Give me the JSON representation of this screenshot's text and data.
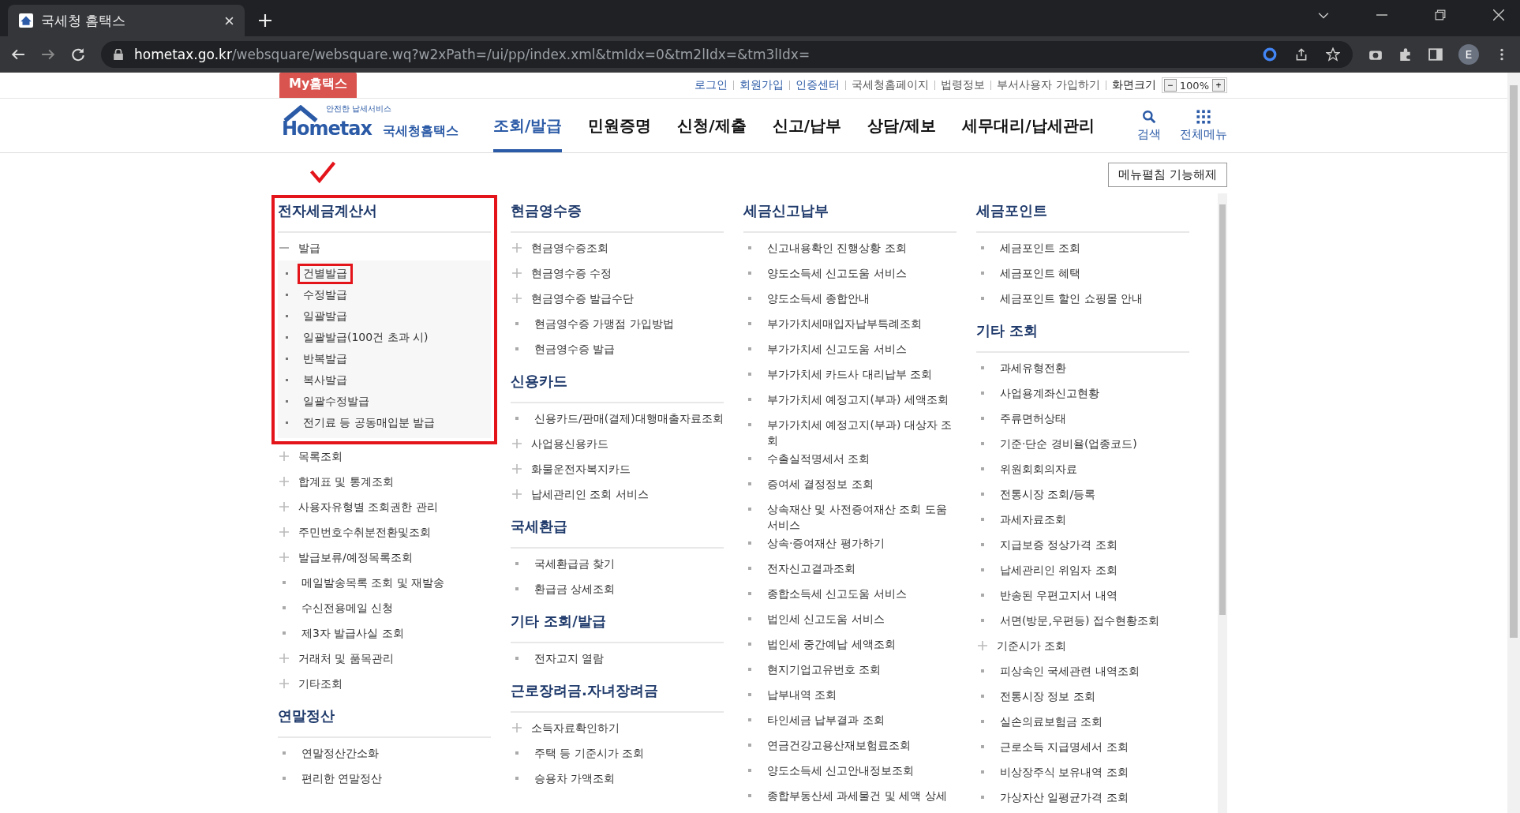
{
  "browser": {
    "tab_title": "국세청 홈택스",
    "url_host": "hometax.go.kr",
    "url_path": "/websquare/websquare.wq?w2xPath=/ui/pp/index.xml&tmIdx=0&tm2lIdx=&tm3lIdx=",
    "profile_initial": "E"
  },
  "my_tab": "My홈택스",
  "util_links": [
    {
      "label": "로그인",
      "kind": "primary"
    },
    {
      "label": "회원가입",
      "kind": "primary"
    },
    {
      "label": "인증센터",
      "kind": "primary"
    },
    {
      "label": "국세청홈페이지",
      "kind": "plain"
    },
    {
      "label": "법령정보",
      "kind": "plain"
    },
    {
      "label": "부서사용자 가입하기",
      "kind": "plain"
    }
  ],
  "zoom": {
    "label": "화면크기",
    "minus": "−",
    "value": "100%",
    "plus": "+"
  },
  "logo": {
    "tagline": "안전한 납세서비스",
    "wordmark": "Hometax",
    "name": "국세청홈택스"
  },
  "nav": [
    {
      "label": "조회/발급",
      "selected": true
    },
    {
      "label": "민원증명",
      "selected": false
    },
    {
      "label": "신청/제출",
      "selected": false
    },
    {
      "label": "신고/납부",
      "selected": false
    },
    {
      "label": "상담/제보",
      "selected": false
    },
    {
      "label": "세무대리/납세관리",
      "selected": false
    }
  ],
  "header_tools": [
    {
      "label": "검색",
      "kind": "search"
    },
    {
      "label": "전체메뉴",
      "kind": "grid"
    }
  ],
  "toggle_button": "메뉴펼침 기능해제",
  "columns": [
    [
      {
        "title": "전자세금계산서",
        "items": [
          {
            "label": "발급",
            "kind": "group",
            "expanded": true,
            "highlighted": true,
            "children": [
              {
                "label": "건별발급",
                "highlighted": true
              },
              {
                "label": "수정발급",
                "highlighted": false
              },
              {
                "label": "일괄발급",
                "highlighted": false
              },
              {
                "label": "일괄발급(100건 초과 시)",
                "highlighted": false
              },
              {
                "label": "반복발급",
                "highlighted": false
              },
              {
                "label": "복사발급",
                "highlighted": false
              },
              {
                "label": "일괄수정발급",
                "highlighted": false
              },
              {
                "label": "전기료 등 공동매입분 발급",
                "highlighted": false
              }
            ]
          },
          {
            "label": "목록조회",
            "kind": "group",
            "expanded": false,
            "highlighted": false
          },
          {
            "label": "합계표 및 통계조회",
            "kind": "group",
            "expanded": false,
            "highlighted": false
          },
          {
            "label": "사용자유형별 조회권한 관리",
            "kind": "group",
            "expanded": false,
            "highlighted": false
          },
          {
            "label": "주민번호수취분전환및조회",
            "kind": "group",
            "expanded": false,
            "highlighted": false
          },
          {
            "label": "발급보류/예정목록조회",
            "kind": "group",
            "expanded": false,
            "highlighted": false
          },
          {
            "label": "메일발송목록 조회 및 재발송",
            "kind": "link",
            "highlighted": false
          },
          {
            "label": "수신전용메일 신청",
            "kind": "link",
            "highlighted": false
          },
          {
            "label": "제3자 발급사실 조회",
            "kind": "link",
            "highlighted": false
          },
          {
            "label": "거래처 및 품목관리",
            "kind": "group",
            "expanded": false,
            "highlighted": false
          },
          {
            "label": "기타조회",
            "kind": "group",
            "expanded": false,
            "highlighted": false
          }
        ]
      },
      {
        "title": "연말정산",
        "items": [
          {
            "label": "연말정산간소화",
            "kind": "link",
            "highlighted": false
          },
          {
            "label": "편리한 연말정산",
            "kind": "link",
            "highlighted": false
          }
        ]
      }
    ],
    [
      {
        "title": "현금영수증",
        "items": [
          {
            "label": "현금영수증조회",
            "kind": "group",
            "expanded": false,
            "highlighted": false
          },
          {
            "label": "현금영수증 수정",
            "kind": "group",
            "expanded": false,
            "highlighted": false
          },
          {
            "label": "현금영수증 발급수단",
            "kind": "group",
            "expanded": false,
            "highlighted": false
          },
          {
            "label": "현금영수증 가맹점 가입방법",
            "kind": "link",
            "highlighted": false
          },
          {
            "label": "현금영수증 발급",
            "kind": "link",
            "highlighted": false
          }
        ]
      },
      {
        "title": "신용카드",
        "items": [
          {
            "label": "신용카드/판매(결제)대행매출자료조회",
            "kind": "link",
            "highlighted": false
          },
          {
            "label": "사업용신용카드",
            "kind": "group",
            "expanded": false,
            "highlighted": false
          },
          {
            "label": "화물운전자복지카드",
            "kind": "group",
            "expanded": false,
            "highlighted": false
          },
          {
            "label": "납세관리인 조회 서비스",
            "kind": "group",
            "expanded": false,
            "highlighted": false
          }
        ]
      },
      {
        "title": "국세환급",
        "items": [
          {
            "label": "국세환급금 찾기",
            "kind": "link",
            "highlighted": false
          },
          {
            "label": "환급금 상세조회",
            "kind": "link",
            "highlighted": false
          }
        ]
      },
      {
        "title": "기타 조회/발급",
        "items": [
          {
            "label": "전자고지 열람",
            "kind": "link",
            "highlighted": false
          }
        ]
      },
      {
        "title": "근로장려금.자녀장려금",
        "items": [
          {
            "label": "소득자료확인하기",
            "kind": "group",
            "expanded": false,
            "highlighted": false
          },
          {
            "label": "주택 등 기준시가 조회",
            "kind": "link",
            "highlighted": false
          },
          {
            "label": "승용차 가액조회",
            "kind": "link",
            "highlighted": false
          }
        ]
      }
    ],
    [
      {
        "title": "세금신고납부",
        "items": [
          {
            "label": "신고내용확인 진행상황 조회",
            "kind": "link",
            "highlighted": false
          },
          {
            "label": "양도소득세 신고도움 서비스",
            "kind": "link",
            "highlighted": false
          },
          {
            "label": "양도소득세 종합안내",
            "kind": "link",
            "highlighted": false
          },
          {
            "label": "부가가치세매입자납부특례조회",
            "kind": "link",
            "highlighted": false
          },
          {
            "label": "부가가치세 신고도움 서비스",
            "kind": "link",
            "highlighted": false
          },
          {
            "label": "부가가치세 카드사 대리납부 조회",
            "kind": "link",
            "highlighted": false
          },
          {
            "label": "부가가치세 예정고지(부과) 세액조회",
            "kind": "link",
            "highlighted": false
          },
          {
            "label": "부가가치세 예정고지(부과) 대상자 조회",
            "kind": "link",
            "highlighted": false
          },
          {
            "label": "수출실적명세서 조회",
            "kind": "link",
            "highlighted": false
          },
          {
            "label": "증여세 결정정보 조회",
            "kind": "link",
            "highlighted": false
          },
          {
            "label": "상속재산 및 사전증여재산 조회 도움 서비스",
            "kind": "link",
            "highlighted": false
          },
          {
            "label": "상속·증여재산 평가하기",
            "kind": "link",
            "highlighted": false
          },
          {
            "label": "전자신고결과조회",
            "kind": "link",
            "highlighted": false
          },
          {
            "label": "종합소득세 신고도움 서비스",
            "kind": "link",
            "highlighted": false
          },
          {
            "label": "법인세 신고도움 서비스",
            "kind": "link",
            "highlighted": false
          },
          {
            "label": "법인세 중간예납 세액조회",
            "kind": "link",
            "highlighted": false
          },
          {
            "label": "현지기업고유번호 조회",
            "kind": "link",
            "highlighted": false
          },
          {
            "label": "납부내역 조회",
            "kind": "link",
            "highlighted": false
          },
          {
            "label": "타인세금 납부결과 조회",
            "kind": "link",
            "highlighted": false
          },
          {
            "label": "연금건강고용산재보험료조회",
            "kind": "link",
            "highlighted": false
          },
          {
            "label": "양도소득세 신고안내정보조회",
            "kind": "link",
            "highlighted": false
          },
          {
            "label": "종합부동산세 과세물건 및 세액 상세",
            "kind": "link",
            "highlighted": false
          }
        ]
      }
    ],
    [
      {
        "title": "세금포인트",
        "items": [
          {
            "label": "세금포인트 조회",
            "kind": "link",
            "highlighted": false
          },
          {
            "label": "세금포인트 혜택",
            "kind": "link",
            "highlighted": false
          },
          {
            "label": "세금포인트 할인 쇼핑몰 안내",
            "kind": "link",
            "highlighted": false
          }
        ]
      },
      {
        "title": "기타 조회",
        "items": [
          {
            "label": "과세유형전환",
            "kind": "link",
            "highlighted": false
          },
          {
            "label": "사업용계좌신고현황",
            "kind": "link",
            "highlighted": false
          },
          {
            "label": "주류면허상태",
            "kind": "link",
            "highlighted": false
          },
          {
            "label": "기준·단순 경비율(업종코드)",
            "kind": "link",
            "highlighted": false
          },
          {
            "label": "위원회회의자료",
            "kind": "link",
            "highlighted": false
          },
          {
            "label": "전통시장 조회/등록",
            "kind": "link",
            "highlighted": false
          },
          {
            "label": "과세자료조회",
            "kind": "link",
            "highlighted": false
          },
          {
            "label": "지급보증 정상가격 조회",
            "kind": "link",
            "highlighted": false
          },
          {
            "label": "납세관리인 위임자 조회",
            "kind": "link",
            "highlighted": false
          },
          {
            "label": "반송된 우편고지서 내역",
            "kind": "link",
            "highlighted": false
          },
          {
            "label": "서면(방문,우편등) 접수현황조회",
            "kind": "link",
            "highlighted": false
          },
          {
            "label": "기준시가 조회",
            "kind": "group",
            "expanded": false,
            "highlighted": false
          },
          {
            "label": "피상속인 국세관련 내역조회",
            "kind": "link",
            "highlighted": false
          },
          {
            "label": "전통시장 정보 조회",
            "kind": "link",
            "highlighted": false
          },
          {
            "label": "실손의료보험금 조회",
            "kind": "link",
            "highlighted": false
          },
          {
            "label": "근로소득 지급명세서 조회",
            "kind": "link",
            "highlighted": false
          },
          {
            "label": "비상장주식 보유내역 조회",
            "kind": "link",
            "highlighted": false
          },
          {
            "label": "가상자산 일평균가격 조회",
            "kind": "link",
            "highlighted": false
          }
        ]
      }
    ]
  ]
}
